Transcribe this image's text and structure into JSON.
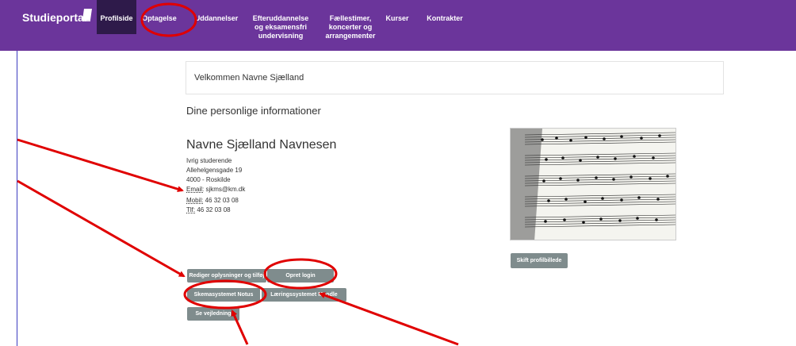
{
  "navbar": {
    "brand": "Studieportal",
    "items": [
      {
        "label": "Profilside"
      },
      {
        "label": "Optagelse"
      },
      {
        "label": "Uddannelser"
      },
      {
        "label": "Efteruddannelse og eksamensfri undervisning"
      },
      {
        "label": "Fællestimer, koncerter og arrangementer"
      },
      {
        "label": "Kurser"
      },
      {
        "label": "Kontrakter"
      }
    ]
  },
  "welcome": {
    "text": "Velkommen Navne Sjælland"
  },
  "section_title": "Dine personlige informationer",
  "profile": {
    "name": "Navne Sjælland Navnesen",
    "status": "Ivrig studerende",
    "address": "Allehelgensgade 19",
    "city": "4000 - Roskilde",
    "email_label": "Email:",
    "email": "sjkms@km.dk",
    "mobile_label": "Mobil:",
    "mobile": "46 32 03 08",
    "phone_label": "Tlf:",
    "phone": "46 32 03 08"
  },
  "buttons": {
    "edit": "Rediger oplysninger og tilføj CV",
    "create_login": "Opret login",
    "schedule": "Skemasystemet Notus",
    "learning": "Læringssystemet Moodle",
    "guide": "Se vejledning",
    "change_photo": "Skift profilbillede"
  },
  "colors": {
    "navbar": "#6b359b",
    "active_nav": "#2e1a4a",
    "button": "#7f8c8d",
    "annotation": "#e00000"
  }
}
